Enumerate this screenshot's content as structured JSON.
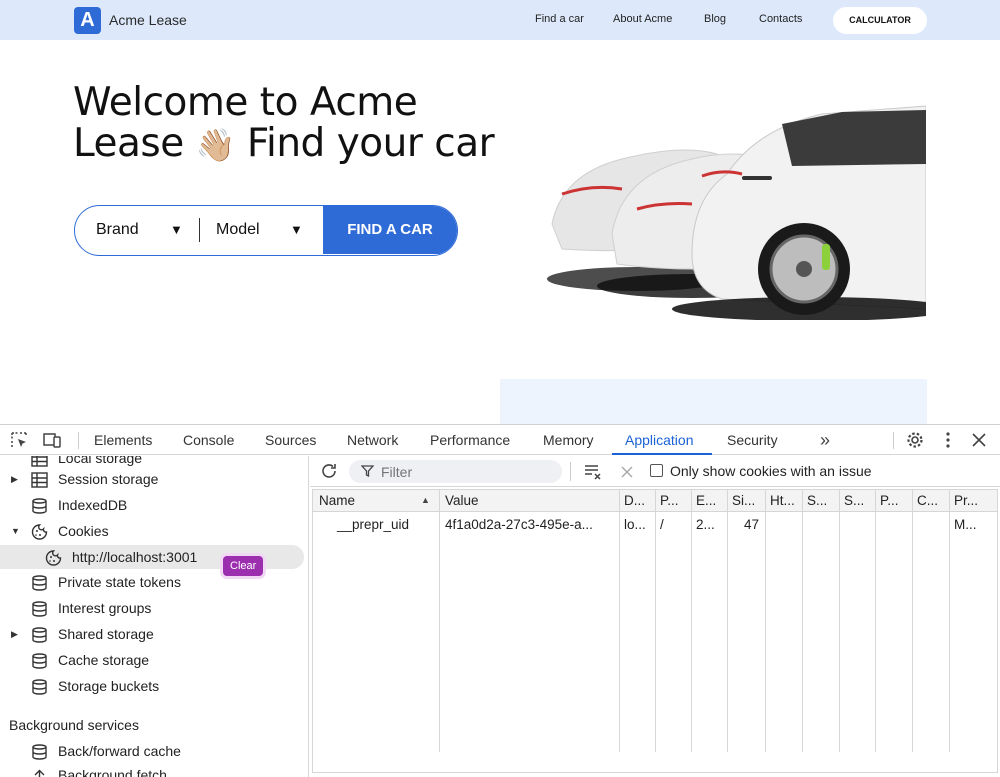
{
  "site": {
    "logo_letter": "A",
    "brand": "Acme Lease",
    "nav": [
      "Find a car",
      "About Acme",
      "Blog",
      "Contacts"
    ],
    "calculator": "CALCULATOR",
    "hero_line1": "Welcome to Acme",
    "hero_line2a": "Lease",
    "hero_emoji": "👋🏼",
    "hero_line2b": "Find your car",
    "brand_select": "Brand",
    "model_select": "Model",
    "find_button": "FIND A CAR",
    "colors": {
      "primary": "#2f6bd7",
      "header_bg": "#dde9fb"
    }
  },
  "devtools": {
    "tabs": [
      "Elements",
      "Console",
      "Sources",
      "Network",
      "Performance",
      "Memory",
      "Application",
      "Security"
    ],
    "active_tab": "Application",
    "more_tabs": "»",
    "sidebar": {
      "partial_top": "Local storage",
      "items": [
        {
          "label": "Session storage",
          "expandable": true,
          "icon": "table-icon"
        },
        {
          "label": "IndexedDB",
          "expandable": false,
          "icon": "database-icon"
        },
        {
          "label": "Cookies",
          "expandable": true,
          "expanded": true,
          "icon": "cookie-icon"
        },
        {
          "label": "http://localhost:3001",
          "selected": true,
          "icon": "cookie-icon"
        },
        {
          "label": "Private state tokens",
          "icon": "database-icon"
        },
        {
          "label": "Interest groups",
          "icon": "database-icon"
        },
        {
          "label": "Shared storage",
          "expandable": true,
          "icon": "database-icon"
        },
        {
          "label": "Cache storage",
          "icon": "database-icon"
        },
        {
          "label": "Storage buckets",
          "icon": "database-icon"
        }
      ],
      "clear_badge": "Clear",
      "section_background": "Background services",
      "bg_items": [
        "Back/forward cache",
        "Background fetch"
      ]
    },
    "toolbar": {
      "filter_placeholder": "Filter",
      "only_issue_label": "Only show cookies with an issue"
    },
    "table": {
      "headers": [
        "Name",
        "Value",
        "D...",
        "P...",
        "E...",
        "Si...",
        "Ht...",
        "S...",
        "S...",
        "P...",
        "C...",
        "Pr..."
      ],
      "rows": [
        [
          "__prepr_uid",
          "4f1a0d2a-27c3-495e-a...",
          "lo...",
          "/",
          "2...",
          "47",
          "",
          "",
          "",
          "",
          "",
          "M..."
        ]
      ]
    }
  }
}
